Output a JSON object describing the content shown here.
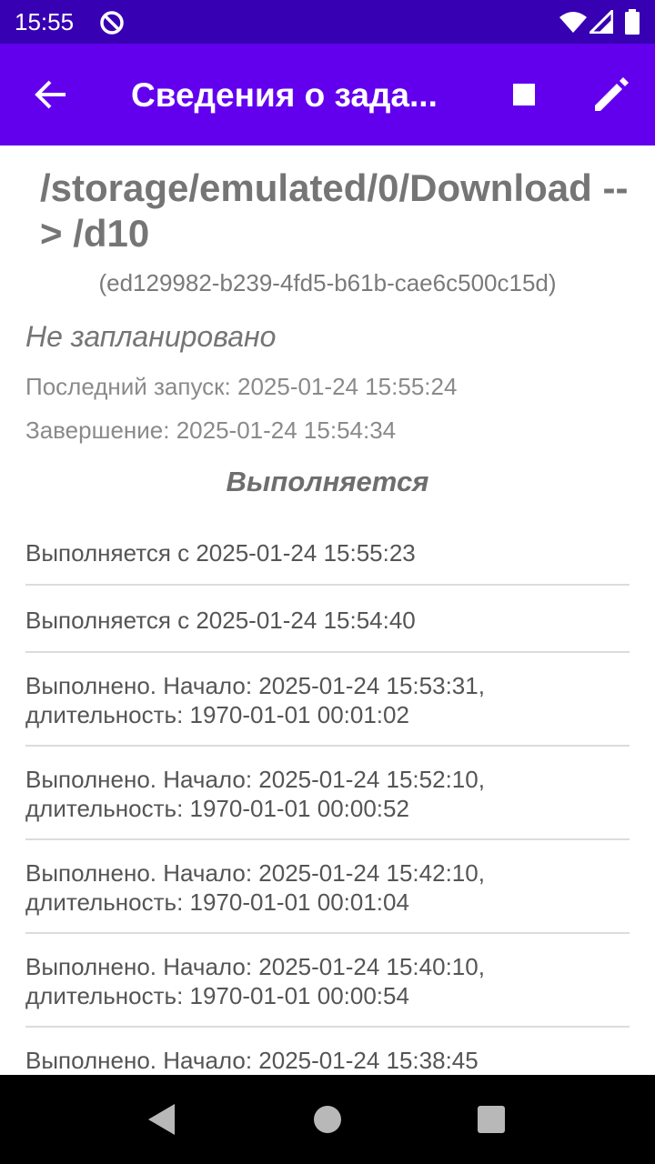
{
  "status_bar": {
    "time": "15:55"
  },
  "app_bar": {
    "title": "Сведения о зада..."
  },
  "task": {
    "path": "/storage/emulated/0/Download --> /d10",
    "id": "(ed129982-b239-4fd5-b61b-cae6c500c15d)",
    "schedule": "Не запланировано",
    "last_run": "Последний запуск: 2025-01-24 15:55:24",
    "finished": "Завершение: 2025-01-24 15:54:34"
  },
  "history": {
    "title": "Выполняется",
    "items": [
      {
        "text": "Выполняется с 2025-01-24 15:55:23"
      },
      {
        "text": "Выполняется с 2025-01-24 15:54:40"
      },
      {
        "text": "Выполнено. Начало: 2025-01-24 15:53:31, длительность: 1970-01-01 00:01:02"
      },
      {
        "text": "Выполнено. Начало: 2025-01-24 15:52:10, длительность: 1970-01-01 00:00:52"
      },
      {
        "text": "Выполнено. Начало: 2025-01-24 15:42:10, длительность: 1970-01-01 00:01:04"
      },
      {
        "text": "Выполнено. Начало: 2025-01-24 15:40:10, длительность: 1970-01-01 00:00:54"
      },
      {
        "text": "Выполнено. Начало: 2025-01-24 15:38:45"
      }
    ]
  },
  "colors": {
    "status_bar": "#3700b3",
    "app_bar": "#6200ee",
    "divider": "#dcdcdc",
    "nav_bar": "#000000"
  },
  "icons": {
    "status": [
      "do-not-disturb-icon",
      "wifi-icon",
      "cellular-signal-icon",
      "battery-icon"
    ],
    "app_bar": [
      "back-arrow-icon",
      "stop-icon",
      "edit-icon"
    ],
    "nav": [
      "nav-back-icon",
      "nav-home-icon",
      "nav-recents-icon"
    ]
  }
}
